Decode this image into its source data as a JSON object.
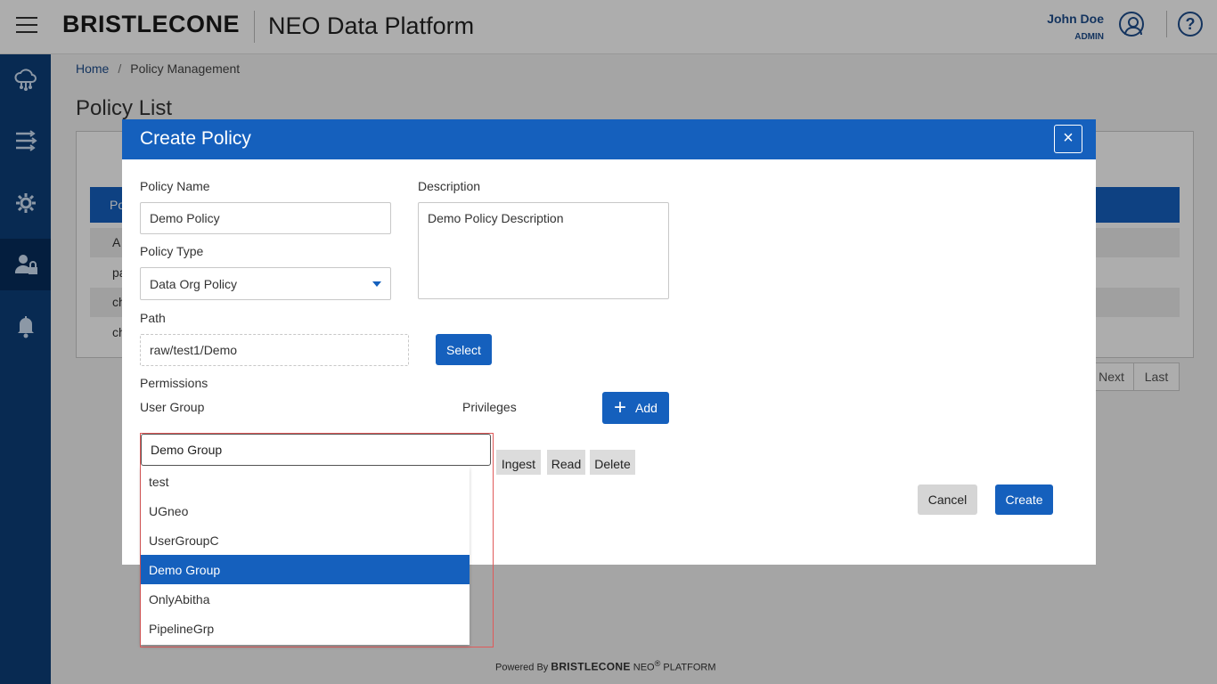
{
  "header": {
    "logo": "BRISTLECONE",
    "app_title": "NEO Data Platform",
    "user_name": "John Doe",
    "user_role": "ADMIN",
    "help": "?"
  },
  "sidebar": {
    "items": [
      {
        "icon": "cloud-network-icon"
      },
      {
        "icon": "pipeline-icon"
      },
      {
        "icon": "settings-gear-icon"
      },
      {
        "icon": "user-lock-icon",
        "active": true
      },
      {
        "icon": "bell-icon"
      }
    ]
  },
  "breadcrumb": {
    "home": "Home",
    "separator": "/",
    "current": "Policy Management"
  },
  "page": {
    "title": "Policy List",
    "table_header": "Po",
    "rows": [
      "A",
      "pa",
      "ch",
      "ch"
    ],
    "pager": {
      "next": "Next",
      "last": "Last"
    }
  },
  "modal": {
    "title": "Create Policy",
    "close": "×",
    "policy_name_label": "Policy Name",
    "policy_name_value": "Demo Policy",
    "description_label": "Description",
    "description_value": "Demo Policy Description",
    "policy_type_label": "Policy Type",
    "policy_type_value": "Data Org Policy",
    "path_label": "Path",
    "path_value": "raw/test1/Demo",
    "select_label": "Select",
    "permissions_label": "Permissions",
    "user_group_label": "User Group",
    "privileges_label": "Privileges",
    "add_icon": "+",
    "add_label": "Add",
    "privileges": [
      "Ingest",
      "Read",
      "Delete"
    ],
    "cancel_label": "Cancel",
    "create_label": "Create"
  },
  "user_group_dropdown": {
    "value": "Demo Group",
    "options": [
      "test",
      "UGneo",
      "UserGroupC",
      "Demo Group",
      "OnlyAbitha",
      "PipelineGrp"
    ],
    "selected": "Demo Group"
  },
  "footer": {
    "powered_by": "Powered By",
    "brand": "BRISTLECONE",
    "product": "NEO",
    "registered": "®",
    "platform": "PLATFORM"
  },
  "colors": {
    "primary": "#1560bd",
    "sidebar": "#0d3f7a",
    "dropdown_outline": "#e05a5a"
  }
}
